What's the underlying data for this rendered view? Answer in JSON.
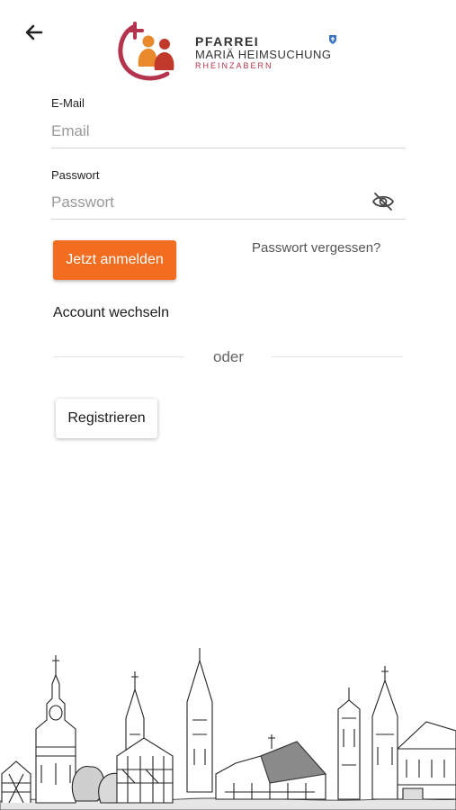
{
  "logo": {
    "line1": "PFARREI",
    "line2": "MARIÄ HEIMSUCHUNG",
    "line3": "RHEINZABERN"
  },
  "form": {
    "email": {
      "label": "E-Mail",
      "placeholder": "Email",
      "value": ""
    },
    "password": {
      "label": "Passwort",
      "placeholder": "Passwort",
      "value": ""
    }
  },
  "actions": {
    "login_label": "Jetzt anmelden",
    "forgot_label": "Passwort vergessen?",
    "switch_account_label": "Account wechseln",
    "divider_label": "oder",
    "register_label": "Registrieren"
  },
  "icons": {
    "back": "arrow-left-icon",
    "password_toggle": "eye-off-icon"
  },
  "colors": {
    "primary": "#f26d1f",
    "logo_red": "#b5344d",
    "logo_orange": "#e8892b",
    "logo_blue": "#3a76c3"
  }
}
